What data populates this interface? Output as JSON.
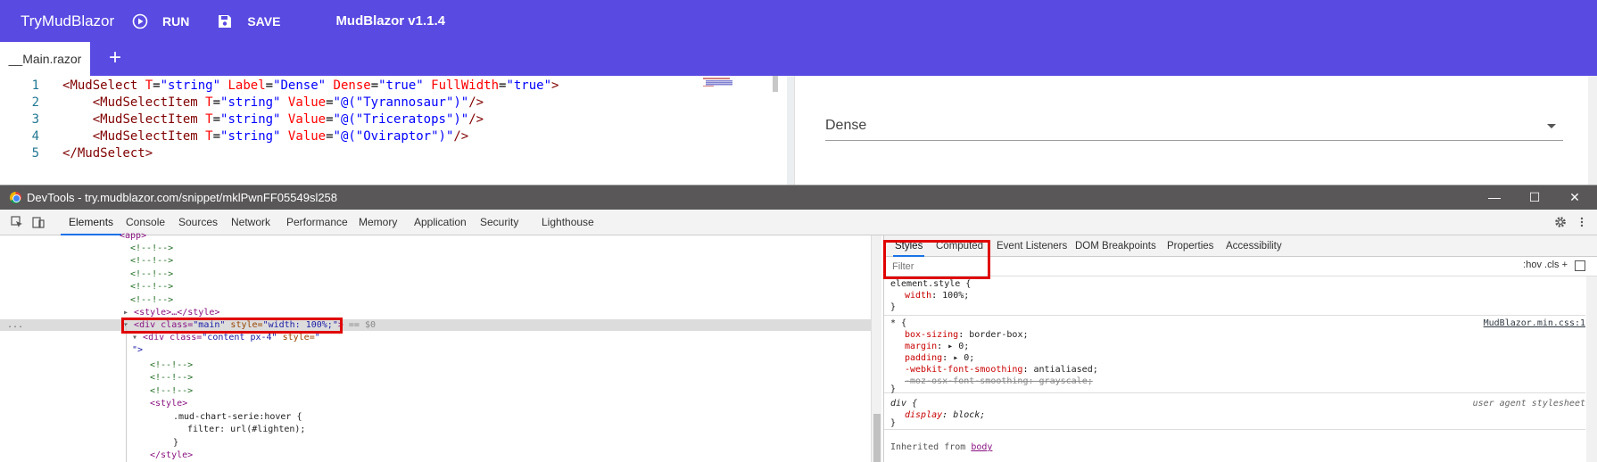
{
  "appbar": {
    "brand": "TryMudBlazor",
    "run_label": "RUN",
    "save_label": "SAVE",
    "version": "MudBlazor v1.1.4",
    "color": "#594ae2"
  },
  "tabs": {
    "active_tab": "__Main.razor",
    "add_icon": "+"
  },
  "editor": {
    "lines": [
      {
        "num": "1"
      },
      {
        "num": "2"
      },
      {
        "num": "3"
      },
      {
        "num": "4"
      },
      {
        "num": "5"
      }
    ],
    "code": {
      "l1_open": "<",
      "l1_tag": "MudSelect",
      "l1_a1": "T",
      "l1_v1": "\"string\"",
      "l1_a2": "Label",
      "l1_v2": "\"Dense\"",
      "l1_a3": "Dense",
      "l1_v3": "\"true\"",
      "l1_a4": "FullWidth",
      "l1_v4": "\"true\"",
      "l1_close": ">",
      "item_tag": "MudSelectItem",
      "item_a1": "T",
      "item_v1": "\"string\"",
      "item_a2": "Value",
      "l2_value": "\"@(\"Tyrannosaur\")\"",
      "l3_value": "\"@(\"Triceratops\")\"",
      "l4_value": "\"@(\"Oviraptor\")\"",
      "item_end": "/>",
      "l5_text": "</MudSelect>"
    }
  },
  "preview": {
    "select_label": "Dense"
  },
  "devtools": {
    "title": "DevTools - try.mudblazor.com/snippet/mklPwnFF05549sl258",
    "window_controls": {
      "minimize": "—",
      "maximize": "☐",
      "close": "✕"
    },
    "panel_tabs": [
      "Elements",
      "Console",
      "Sources",
      "Network",
      "Performance",
      "Memory",
      "Application",
      "Security",
      "Lighthouse"
    ],
    "active_panel": "Elements",
    "dom": {
      "app_tag": "<app>",
      "comment": "<!--!-->",
      "style_collapsed": "<style>…</style>",
      "main_open": "<div class=",
      "main_class": "\"main\"",
      "main_style_attr": " style=",
      "main_style_val": "\"width: 100%;\"",
      "main_close": ">",
      "main_ref": " == $0",
      "content_open": "<div class=",
      "content_class": "\"content px-4\"",
      "content_style_attr": " style=",
      "content_style_val": "\"",
      "content_end": "\">",
      "style_open": "<style>",
      "css_selector": ".mud-chart-serie:hover {",
      "css_filter": "filter: url(#lighten);",
      "css_brace": "}",
      "style_close": "</style>",
      "dots": "..."
    },
    "styles": {
      "tabs": [
        "Styles",
        "Computed",
        "Event Listeners",
        "DOM Breakpoints",
        "Properties",
        "Accessibility"
      ],
      "active_tab": "Styles",
      "filter_placeholder": "Filter",
      "filter_tools": ":hov  .cls  +",
      "element_style_selector": "element.style {",
      "element_style_prop": "width",
      "element_style_val": "100%;",
      "close_brace": "}",
      "universal_selector": "* {",
      "universal_source": "MudBlazor.min.css:1",
      "universal_props": [
        {
          "name": "box-sizing",
          "value": "border-box;"
        },
        {
          "name": "margin",
          "value": "▸ 0;"
        },
        {
          "name": "padding",
          "value": "▸ 0;"
        },
        {
          "name": "-webkit-font-smoothing",
          "value": "antialiased;"
        },
        {
          "name": "-moz-osx-font-smoothing",
          "value": "grayscale;"
        }
      ],
      "div_selector": "div {",
      "div_source": "user agent stylesheet",
      "div_prop": "display",
      "div_val": "block;",
      "inherited_label": "Inherited from ",
      "inherited_from": "body"
    }
  }
}
